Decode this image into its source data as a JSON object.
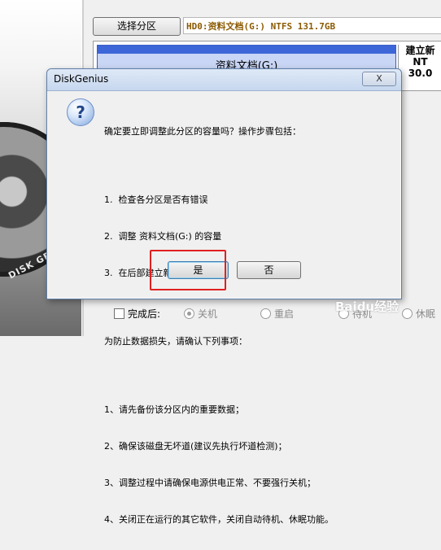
{
  "top": {
    "select_partition_label": "选择分区",
    "partition_info": "HD0:资料文档(G:) NTFS 131.7GB"
  },
  "partition_map": {
    "main_label": "资料文档(G:)",
    "new_line1": "建立新",
    "new_line2": "NT",
    "new_line3": "30.0"
  },
  "banner": {
    "disk_text": "DISK GE"
  },
  "dialog": {
    "title": "DiskGenius",
    "close_label": "X",
    "icon": "question-icon",
    "icon_glyph": "?",
    "intro": "确定要立即调整此分区的容量吗？操作步骤包括：",
    "steps": [
      "1.  检查各分区是否有错误",
      "2.  调整 资料文档(G:) 的容量",
      "3.  在后部建立新分区"
    ],
    "notice_title": "为防止数据损失，请确认下列事项：",
    "notices": [
      "1、请先备份该分区内的重要数据；",
      "2、确保该磁盘无坏道(建议先执行坏道检测)；",
      "3、调整过程中请确保电源供电正常、不要强行关机；",
      "4、关闭正在运行的其它软件，关闭自动待机、休眠功能。"
    ],
    "yes_label": "是",
    "no_label": "否"
  },
  "options": {
    "finish_label": "完成后:",
    "shutdown_label": "关机",
    "restart_label": "重启",
    "standby_label": "待机",
    "hibernate_label": "休眠"
  },
  "watermark": "Baidu经验",
  "colors": {
    "highlight": "#e0201f",
    "partition_blue": "#3d67d8"
  }
}
